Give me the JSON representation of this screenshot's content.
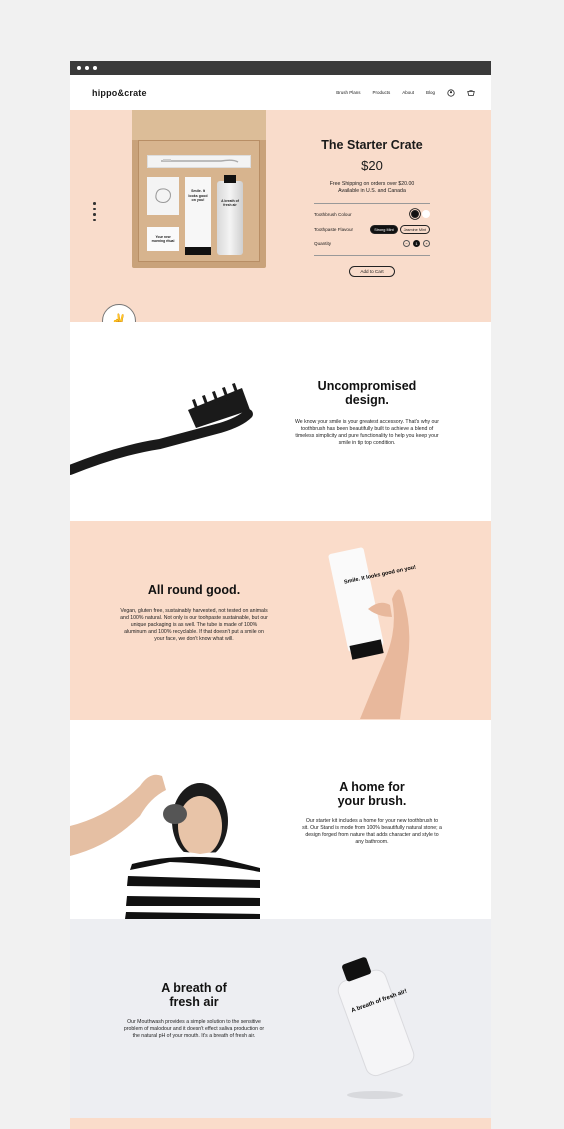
{
  "brand": {
    "logo": "hippo&crate"
  },
  "nav": {
    "links": [
      "Brush Plans",
      "Products",
      "About",
      "Blog"
    ]
  },
  "hero": {
    "product_title": "The Starter Crate",
    "price": "$20",
    "shipping_line1": "Free Shipping on orders over $20.00",
    "shipping_line2": "Available in U.S. and Canada",
    "colour_label": "Toothbrush Colour",
    "flavour_label": "Toothpaste Flavour",
    "flavour_options": [
      "Strong Mint",
      "Jasmine Mint"
    ],
    "quantity_label": "Quantity",
    "quantity_value": "1",
    "add_to_cart": "Add to Cart",
    "box_card_1": "Smile. It looks good on you!",
    "box_card_2": "A breath of fresh air",
    "box_card_3": "Your new morning ritual"
  },
  "sections": [
    {
      "title1": "Uncompromised",
      "title2": "design.",
      "body": "We know your smile is your greatest accessory. That's why our toothbrush has been beautifully built to achieve a blend of timeless simplicity and pure functionality to help you keep your smile in tip top condition."
    },
    {
      "title1": "All round good.",
      "title2": "",
      "body": "Vegan, gluten free, sustainably harvested, not tested on animals and 100% natural. Not only is our toohpaste sustainable, but our unique packaging is as well. The tube is made of 100% aluminum and 100% recyclable. If that doesn't put a smile on your face, we don't know what will."
    },
    {
      "title1": "A home for",
      "title2": "your brush.",
      "body": "Our starter kit includes a home for your new toothbrush to sit. Our Stand is mode from 100% beautifully natural stone; a design forged from nature that adds character and style to any bathroom."
    },
    {
      "title1": "A breath of",
      "title2": "fresh air",
      "body": "Our Mouthwash provides a simple solution to the sensitive problem of malodour and it doesn't effect saliva production or the natural pH of your mouth. It's a breath of fresh air."
    }
  ],
  "product_labels": {
    "tube": "Smile. It looks good on you!",
    "bottle": "A breath of fresh air!"
  },
  "colors": {
    "peach": "#f9dccb",
    "light_grey": "#edeef2",
    "dark": "#111111"
  }
}
